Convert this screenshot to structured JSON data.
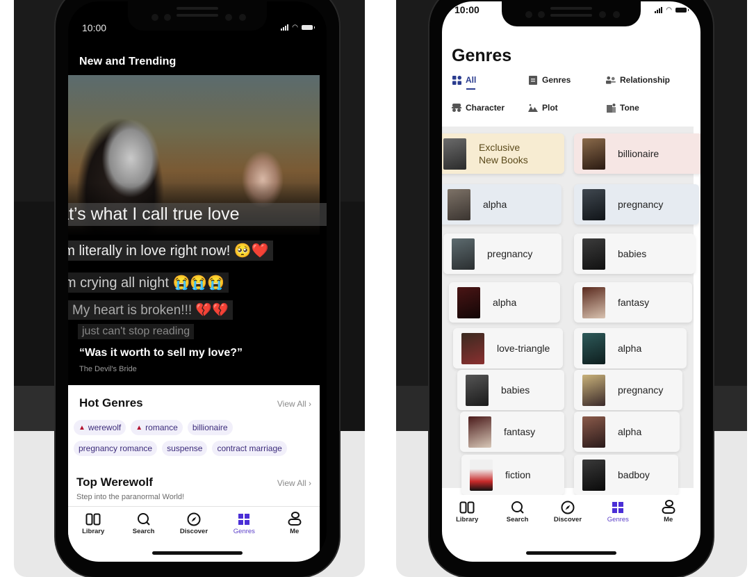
{
  "left_phone": {
    "status_bar": {
      "time": "10:00"
    },
    "header_title": "New and Trending",
    "comments": [
      "That’s what I call true love",
      "I am literally in love right now! 🥺❤️",
      "i’m crying all night  😭😭😭",
      "My heart is broken!!!  💔💔",
      "just can't stop reading"
    ],
    "quote": "“Was it worth to sell my love?”",
    "quote_source": "The Devil's Bride",
    "hot_genres": {
      "title": "Hot Genres",
      "view_all": "View All ›",
      "chips": [
        {
          "label": "werewolf",
          "icon": "flame-icon"
        },
        {
          "label": "romance",
          "icon": "flame-icon"
        },
        {
          "label": "billionaire"
        },
        {
          "label": "pregnancy romance"
        },
        {
          "label": "suspense"
        },
        {
          "label": "contract marriage"
        }
      ]
    },
    "top_werewolf": {
      "title": "Top Werewolf",
      "view_all": "View All ›",
      "subtitle": "Step into the paranormal World!"
    }
  },
  "right_phone": {
    "status_bar": {
      "time": "10:00"
    },
    "page_title": "Genres",
    "filters": [
      {
        "label": "All",
        "icon": "grid-icon",
        "active": true
      },
      {
        "label": "Genres",
        "icon": "book-icon"
      },
      {
        "label": "Relationship",
        "icon": "people-icon"
      },
      {
        "label": "Character",
        "icon": "mask-icon"
      },
      {
        "label": "Plot",
        "icon": "mountain-icon"
      },
      {
        "label": "Tone",
        "icon": "note-icon"
      }
    ],
    "cards": [
      {
        "label": "Exclusive New Books",
        "style": "exclusive"
      },
      {
        "label": "billionaire",
        "style": "pinkish"
      },
      {
        "label": "alpha",
        "style": "blueish"
      },
      {
        "label": "pregnancy",
        "style": "blueish"
      },
      {
        "label": "pregnancy"
      },
      {
        "label": "babies"
      },
      {
        "label": "alpha"
      },
      {
        "label": "fantasy"
      },
      {
        "label": "love-triangle"
      },
      {
        "label": "alpha"
      },
      {
        "label": "babies"
      },
      {
        "label": "pregnancy"
      },
      {
        "label": "fantasy"
      },
      {
        "label": "alpha"
      },
      {
        "label": "fiction"
      },
      {
        "label": "badboy"
      }
    ]
  },
  "tab_bar": {
    "items": [
      {
        "label": "Library",
        "icon": "library-icon"
      },
      {
        "label": "Search",
        "icon": "search-icon"
      },
      {
        "label": "Discover",
        "icon": "compass-icon"
      },
      {
        "label": "Genres",
        "icon": "genres-grid-icon",
        "active": true
      },
      {
        "label": "Me",
        "icon": "profile-icon"
      }
    ]
  },
  "colors": {
    "accent": "#5a3ec8",
    "tab_active_icon": "#4b2fd6",
    "filter_active": "#2a3c8f",
    "chip_bg": "#f1effa",
    "chip_text": "#3b2b7a",
    "flame": "#b3122e",
    "exclusive_card": "#f7ecd2",
    "billionaire_card": "#f6e6e4",
    "blue_card": "#e6ebf1"
  }
}
